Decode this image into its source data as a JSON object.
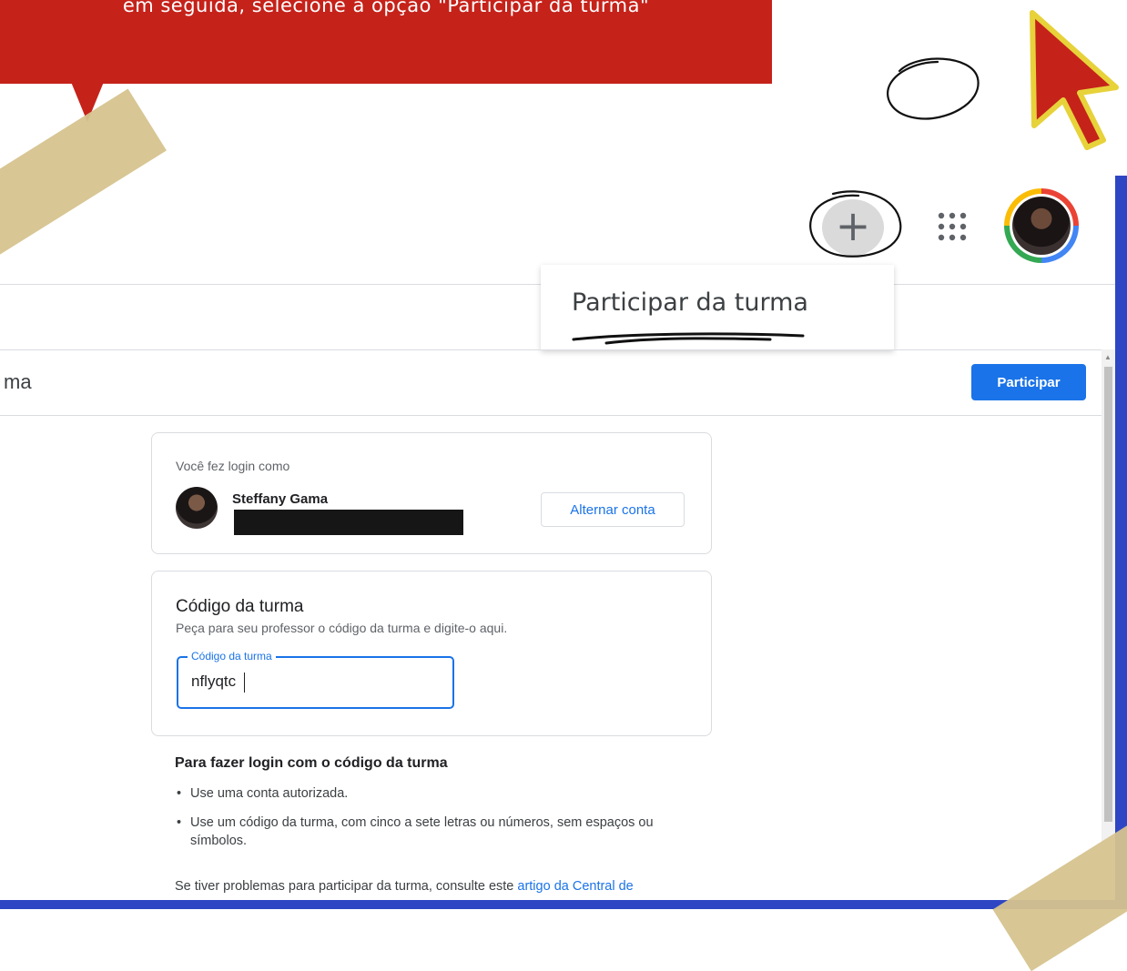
{
  "callout": {
    "text": "em seguida, selecione a opção \"Participar da turma\"",
    "color": "#c5221a"
  },
  "topbar": {
    "add_icon": "plus-icon",
    "add_glyph": "+",
    "apps_icon": "grid-apps-icon",
    "account_icon": "account-avatar"
  },
  "menu": {
    "items": [
      {
        "label": "Participar da turma"
      }
    ]
  },
  "page": {
    "title_partial": "ma",
    "join_label": "Participar"
  },
  "login_card": {
    "label": "Você fez login como",
    "user_name": "Steffany Gama",
    "switch_label": "Alternar conta"
  },
  "code_card": {
    "title": "Código da turma",
    "description": "Peça para seu professor o código da turma e digite-o aqui.",
    "field_label": "Código da turma",
    "field_value": "nflyqtc"
  },
  "help": {
    "title": "Para fazer login com o código da turma",
    "items": [
      "Use uma conta autorizada.",
      "Use um código da turma, com cinco a sete letras ou números, sem espaços ou símbolos."
    ],
    "footer_text": "Se tiver problemas para participar da turma, consulte este ",
    "footer_link": "artigo da Central de"
  },
  "colors": {
    "accent_blue": "#1a73e8",
    "frame_blue": "#2e46c4",
    "tape": "#d6c38e",
    "cursor_red": "#c5221a",
    "cursor_outline": "#e7d23a"
  }
}
